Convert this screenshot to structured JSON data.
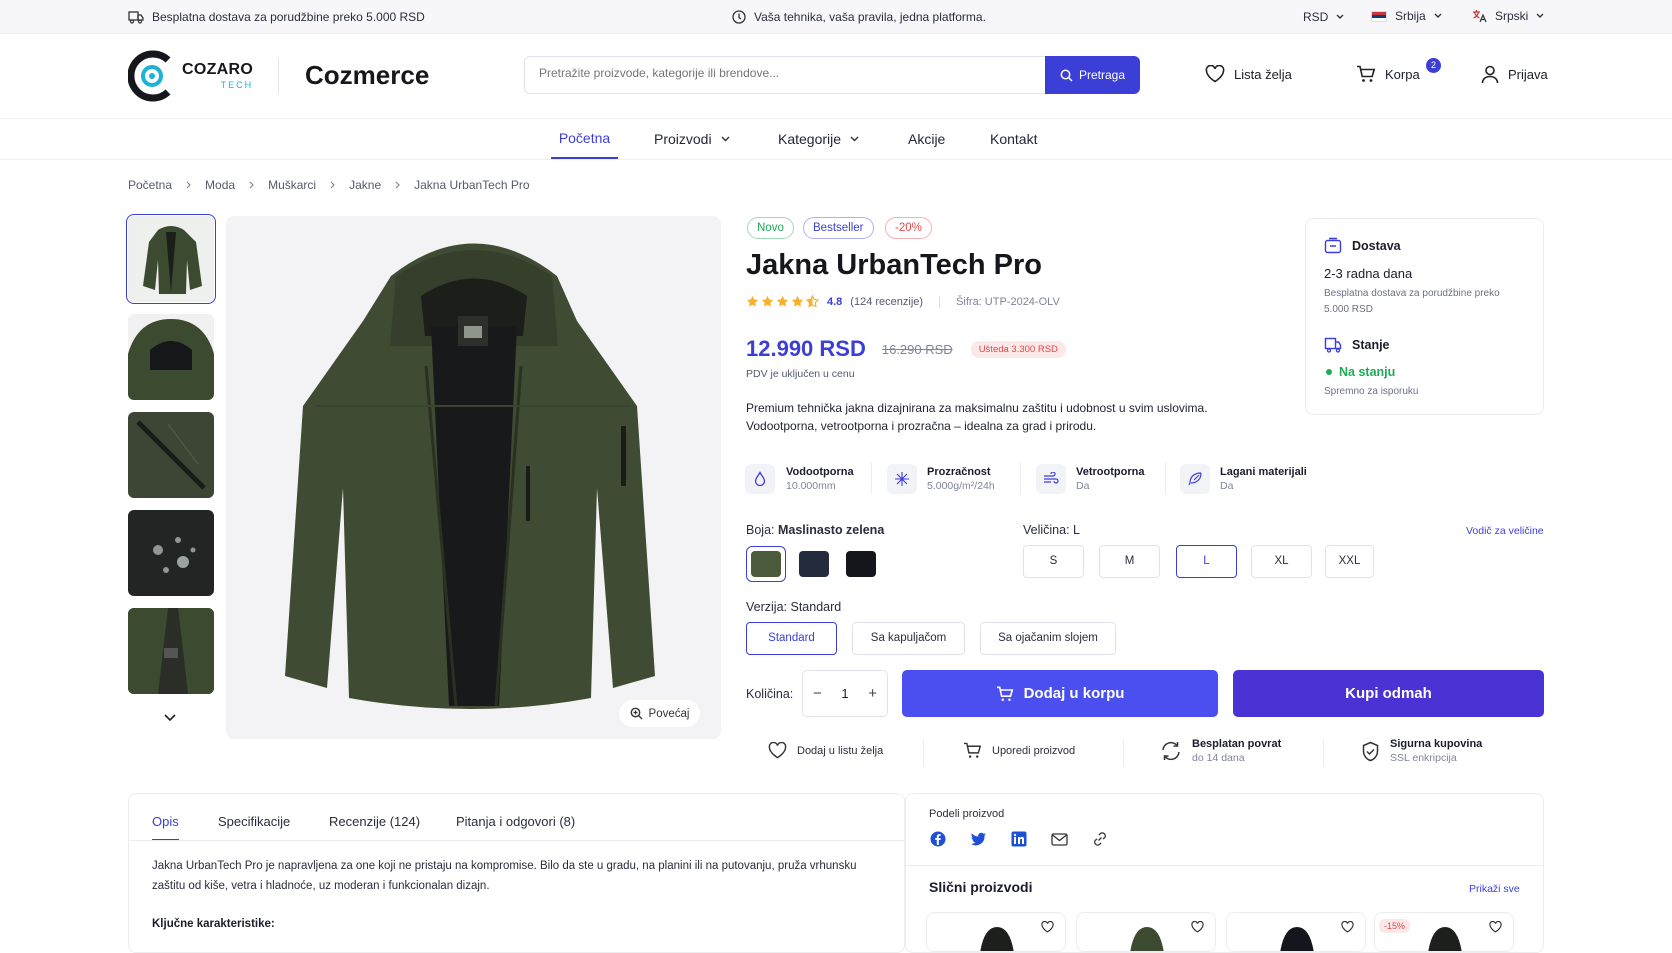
{
  "topbar": {
    "shipping": "Besplatna dostava za porudžbine preko 5.000 RSD",
    "slogan": "Vaša tehnika, vaša pravila, jedna platforma.",
    "currency": "RSD",
    "country": "Srbija",
    "language": "Srpski"
  },
  "header": {
    "logo_main": "COZARO",
    "logo_sub": "TECH",
    "brand": "Cozmerce",
    "search_placeholder": "Pretražite proizvode, kategorije ili brendove...",
    "search_button": "Pretraga",
    "wishlist": "Lista želja",
    "cart": "Korpa",
    "cart_count": "2",
    "login": "Prijava"
  },
  "nav": {
    "home": "Početna",
    "products": "Proizvodi",
    "categories": "Kategorije",
    "sales": "Akcije",
    "contact": "Kontakt"
  },
  "breadcrumb": [
    "Početna",
    "Moda",
    "Muškarci",
    "Jakne",
    "Jakna UrbanTech Pro"
  ],
  "gallery": {
    "zoom": "Povećaj"
  },
  "product": {
    "badges": {
      "new": "Novo",
      "bestseller": "Bestseller",
      "discount": "-20%"
    },
    "title": "Jakna UrbanTech Pro",
    "rating_value": "4.8",
    "rating_stars": 4.5,
    "reviews": "(124 recenzije)",
    "sku": "Šifra: UTP-2024-OLV",
    "price": "12.990 RSD",
    "old_price": "16.290 RSD",
    "savings": "Ušteda 3.300 RSD",
    "vat": "PDV je uključen u cenu",
    "description_1": "Premium tehnička jakna dizajnirana za maksimalnu zaštitu i udobnost u svim uslovima.",
    "description_2": "Vodootporna, vetrootporna i prozračna – idealna za grad i prirodu.",
    "features": [
      {
        "title": "Vodootporna",
        "sub": "10.000mm",
        "icon": "droplet-icon"
      },
      {
        "title": "Prozračnost",
        "sub": "5.000g/m²/24h",
        "icon": "airflow-icon"
      },
      {
        "title": "Vetrootporna",
        "sub": "Da",
        "icon": "wind-icon"
      },
      {
        "title": "Lagani materijali",
        "sub": "Da",
        "icon": "feather-icon"
      }
    ],
    "color_label": "Boja:",
    "color_value": "Maslinasto zelena",
    "colors": [
      "#4b5a3a",
      "#242b3d",
      "#15161b"
    ],
    "size_label": "Veličina:",
    "size_value": "L",
    "size_guide": "Vodič za veličine",
    "sizes": [
      "S",
      "M",
      "L",
      "XL",
      "XXL"
    ],
    "version_label": "Verzija:",
    "version_value": "Standard",
    "versions": [
      "Standard",
      "Sa kapuljačom",
      "Sa ojačanim slojem"
    ],
    "qty_label": "Količina:",
    "qty": "1",
    "add_to_cart": "Dodaj u korpu",
    "buy_now": "Kupi odmah",
    "actions": {
      "wishlist": "Dodaj u listu želja",
      "compare": "Uporedi proizvod",
      "returns_title": "Besplatan povrat",
      "returns_sub": "do 14 dana",
      "secure_title": "Sigurna kupovina",
      "secure_sub": "SSL enkripcija"
    }
  },
  "delivery": {
    "title": "Dostava",
    "time": "2-3 radna dana",
    "note": "Besplatna dostava za porudžbine preko 5.000 RSD",
    "stock_title": "Stanje",
    "stock_status": "Na stanju",
    "stock_note": "Spremno za isporuku"
  },
  "tabs": {
    "items": [
      "Opis",
      "Specifikacije",
      "Recenzije (124)",
      "Pitanja i odgovori (8)"
    ],
    "desc_1": "Jakna UrbanTech Pro je napravljena za one koji ne pristaju na kompromise. Bilo da ste u gradu, na planini ili na putovanju, pruža vrhunsku",
    "desc_2": "zaštitu od kiše, vetra i hladnoće, uz moderan i funkcionalan dizajn.",
    "key_features": "Ključne karakteristike:"
  },
  "share": {
    "title": "Podeli proizvod",
    "similar": "Slični proizvodi",
    "show_all": "Prikaži sve",
    "similar_badge": "-15%"
  },
  "colors": {
    "accent": "#3b3fd8",
    "accent_dark": "#4a32d4",
    "green": "#1faa55",
    "red": "#e14848"
  }
}
